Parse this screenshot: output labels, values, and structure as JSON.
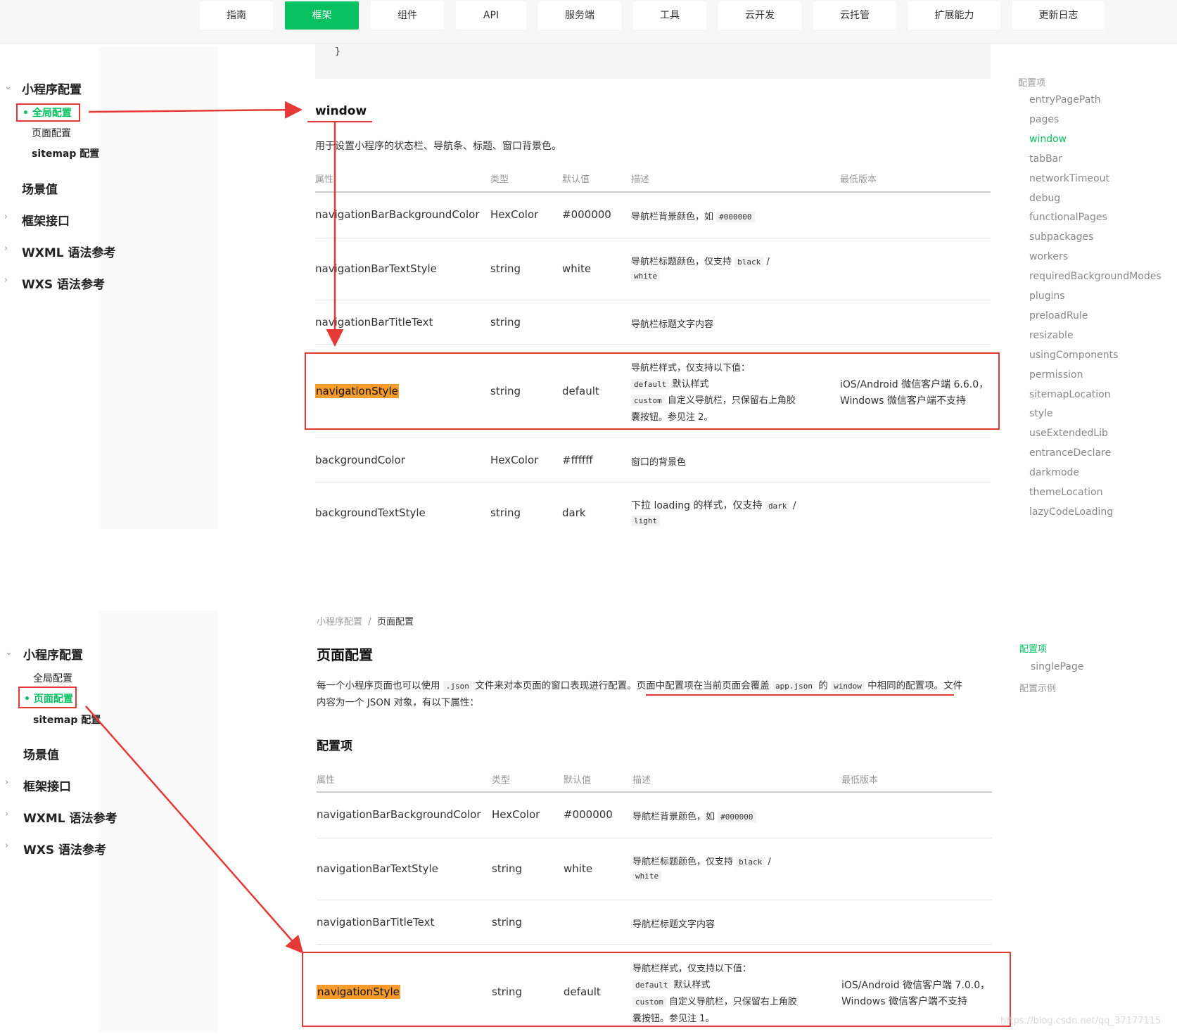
{
  "nav": {
    "tabs": [
      {
        "label": "指南",
        "active": false
      },
      {
        "label": "框架",
        "active": true
      },
      {
        "label": "组件",
        "active": false
      },
      {
        "label": "API",
        "active": false
      },
      {
        "label": "服务端",
        "active": false
      },
      {
        "label": "工具",
        "active": false
      },
      {
        "label": "云开发",
        "active": false
      },
      {
        "label": "云托管",
        "active": false
      },
      {
        "label": "扩展能力",
        "active": false
      },
      {
        "label": "更新日志",
        "active": false
      }
    ]
  },
  "sidebar_top": {
    "group": "小程序配置",
    "subs": [
      "全局配置",
      "页面配置",
      "sitemap 配置"
    ],
    "active_sub": "全局配置",
    "items": [
      "场景值",
      "框架接口",
      "WXML 语法参考",
      "WXS 语法参考"
    ]
  },
  "sidebar_bottom": {
    "group": "小程序配置",
    "subs": [
      "全局配置",
      "页面配置",
      "sitemap 配置"
    ],
    "active_sub": "页面配置",
    "items": [
      "场景值",
      "框架接口",
      "WXML 语法参考",
      "WXS 语法参考"
    ]
  },
  "top_section": {
    "code_tail": "}",
    "heading": "window",
    "description": "用于设置小程序的状态栏、导航条、标题、窗口背景色。",
    "headers": [
      "属性",
      "类型",
      "默认值",
      "描述",
      "最低版本"
    ],
    "rows": [
      {
        "name": "navigationBarBackgroundColor",
        "type": "HexColor",
        "default": "#000000",
        "desc_pre": "导航栏背景颜色，如",
        "desc_code": "#000000"
      },
      {
        "name": "navigationBarTextStyle",
        "type": "string",
        "default": "white",
        "desc_pre": "导航栏标题颜色，仅支持",
        "desc_code": "black",
        "desc_sep": "/",
        "desc_code2": "white"
      },
      {
        "name": "navigationBarTitleText",
        "type": "string",
        "default": "",
        "desc_pre": "导航栏标题文字内容"
      },
      {
        "name": "navigationStyle",
        "type": "string",
        "default": "default",
        "desc_l1": "导航栏样式，仅支持以下值：",
        "desc_c1": "default",
        "desc_t1": "默认样式",
        "desc_c2": "custom",
        "desc_t2": "自定义导航栏，只保留右上角胶",
        "desc_l4": "囊按钮。参见注 2。",
        "version_l1": "iOS/Android 微信客户端 6.6.0，",
        "version_l2": "Windows 微信客户端不支持"
      },
      {
        "name": "backgroundColor",
        "type": "HexColor",
        "default": "#ffffff",
        "desc_pre": "窗口的背景色"
      },
      {
        "name": "backgroundTextStyle",
        "type": "string",
        "default": "dark",
        "desc_pre": "下拉 loading 的样式，仅支持",
        "desc_code": "dark",
        "desc_sep": "/",
        "desc_code2": "light"
      }
    ]
  },
  "toc_top": {
    "title": "配置项",
    "items": [
      "entryPagePath",
      "pages",
      "window",
      "tabBar",
      "networkTimeout",
      "debug",
      "functionalPages",
      "subpackages",
      "workers",
      "requiredBackgroundModes",
      "plugins",
      "preloadRule",
      "resizable",
      "usingComponents",
      "permission",
      "sitemapLocation",
      "style",
      "useExtendedLib",
      "entranceDeclare",
      "darkmode",
      "themeLocation",
      "lazyCodeLoading"
    ],
    "active": "window"
  },
  "bottom_section": {
    "breadcrumb_parent": "小程序配置",
    "breadcrumb_sep": "/",
    "breadcrumb_current": "页面配置",
    "title": "页面配置",
    "intro_a": "每一个小程序页面也可以使用",
    "intro_code1": ".json",
    "intro_b": "文件来对本页面的窗口表现进行配置。页面中配置项在当前页面会覆盖",
    "intro_code2": "app.json",
    "intro_c": "的",
    "intro_code3": "window",
    "intro_d": "中相同的配置项。文件",
    "intro_line2": "内容为一个 JSON 对象，有以下属性：",
    "subheading": "配置项",
    "headers": [
      "属性",
      "类型",
      "默认值",
      "描述",
      "最低版本"
    ],
    "rows": [
      {
        "name": "navigationBarBackgroundColor",
        "type": "HexColor",
        "default": "#000000",
        "desc_pre": "导航栏背景颜色，如",
        "desc_code": "#000000"
      },
      {
        "name": "navigationBarTextStyle",
        "type": "string",
        "default": "white",
        "desc_pre": "导航栏标题颜色，仅支持",
        "desc_code": "black",
        "desc_sep": "/",
        "desc_code2": "white"
      },
      {
        "name": "navigationBarTitleText",
        "type": "string",
        "default": "",
        "desc_pre": "导航栏标题文字内容"
      },
      {
        "name": "navigationStyle",
        "type": "string",
        "default": "default",
        "desc_l1": "导航栏样式，仅支持以下值：",
        "desc_c1": "default",
        "desc_t1": "默认样式",
        "desc_c2": "custom",
        "desc_t2": "自定义导航栏，只保留右上角胶",
        "desc_l4": "囊按钮。参见注 1。",
        "version_l1": "iOS/Android 微信客户端 7.0.0，",
        "version_l2": "Windows 微信客户端不支持"
      }
    ]
  },
  "toc_bottom": {
    "title": "配置项",
    "items": [
      "singlePage"
    ],
    "extra": "配置示例"
  },
  "watermark": "https://blog.csdn.net/qq_37177115",
  "colors": {
    "accent": "#07c160",
    "annotation": "#e53935",
    "highlight": "#f59b2b"
  }
}
